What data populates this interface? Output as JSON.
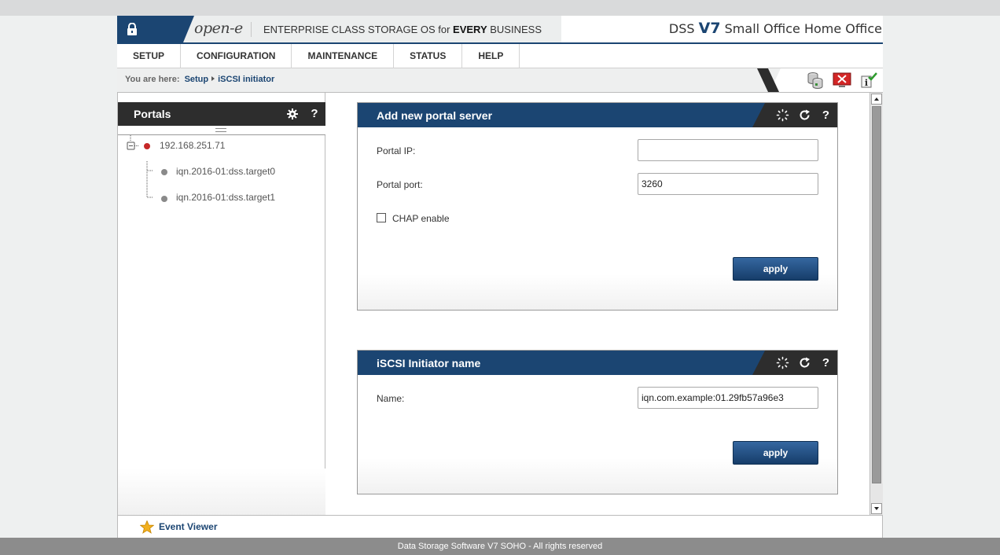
{
  "header": {
    "logo": "open-e",
    "tagline_pre": "ENTERPRISE CLASS STORAGE OS for ",
    "tagline_bold": "EVERY",
    "tagline_post": " BUSINESS",
    "product_dss": "DSS ",
    "product_v7": "V7",
    "product_edition": " Small Office Home Office"
  },
  "menu": [
    "SETUP",
    "CONFIGURATION",
    "MAINTENANCE",
    "STATUS",
    "HELP"
  ],
  "breadcrumb": {
    "prefix": "You are here:",
    "items": [
      "Setup",
      "iSCSI initiator"
    ]
  },
  "portals": {
    "title": "Portals",
    "tree": {
      "root": "192.168.251.71",
      "children": [
        "iqn.2016-01:dss.target0",
        "iqn.2016-01:dss.target1"
      ]
    }
  },
  "add_portal": {
    "title": "Add new portal server",
    "portal_ip_label": "Portal IP:",
    "portal_ip_value": "",
    "portal_port_label": "Portal port:",
    "portal_port_value": "3260",
    "chap_label": "CHAP enable",
    "apply": "apply"
  },
  "initiator": {
    "title": "iSCSI Initiator name",
    "name_label": "Name:",
    "name_value": "iqn.com.example:01.29fb57a96e3",
    "apply": "apply"
  },
  "event_viewer": "Event Viewer",
  "footer": "Data Storage Software V7 SOHO - All rights reserved",
  "colors": {
    "brand_blue": "#1b4572",
    "panel_dark": "#2d2d2d",
    "root_dot": "#c62828",
    "child_dot": "#8a8a8a"
  }
}
